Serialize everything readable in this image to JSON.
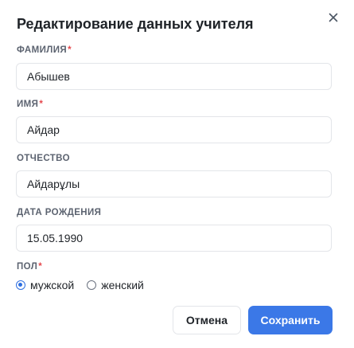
{
  "dialog": {
    "title": "Редактирование данных учителя"
  },
  "fields": {
    "last_name": {
      "label": "ФАМИЛИЯ",
      "required_mark": "*",
      "value": "Абышев"
    },
    "first_name": {
      "label": "ИМЯ",
      "required_mark": "*",
      "value": "Айдар"
    },
    "patronymic": {
      "label": "ОТЧЕСТВО",
      "value": "Айдарұлы"
    },
    "birth_date": {
      "label": "ДАТА РОЖДЕНИЯ",
      "value": "15.05.1990"
    },
    "gender": {
      "label": "ПОЛ",
      "required_mark": "*",
      "options": [
        "мужской",
        "женский"
      ],
      "selected": "мужской"
    }
  },
  "actions": {
    "cancel_label": "Отмена",
    "save_label": "Сохранить"
  },
  "colors": {
    "accent": "#3b78e7",
    "required": "#e5484d"
  },
  "icons": {
    "close": "close-icon"
  }
}
